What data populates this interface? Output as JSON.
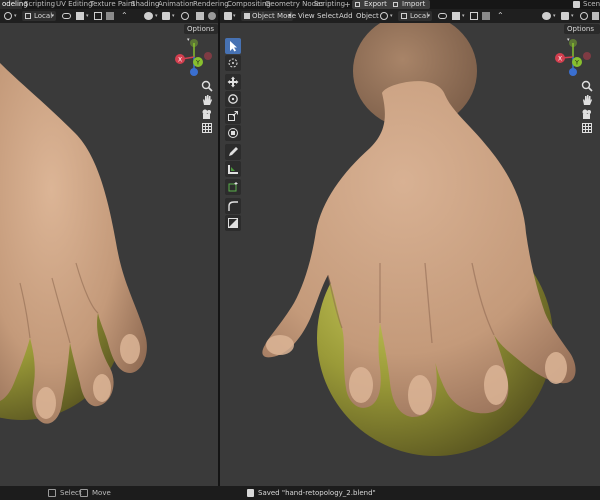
{
  "workspace_tabs": [
    {
      "label": "odeling",
      "active": true
    },
    {
      "label": "Scripting",
      "active": false
    },
    {
      "label": "UV Editing",
      "active": false
    },
    {
      "label": "Texture Paint",
      "active": false
    },
    {
      "label": "Shading",
      "active": false
    },
    {
      "label": "Animation",
      "active": false
    },
    {
      "label": "Rendering",
      "active": false
    },
    {
      "label": "Compositing",
      "active": false
    },
    {
      "label": "Geometry Nodes",
      "active": false
    },
    {
      "label": "Scripting",
      "active": false
    }
  ],
  "add_tab_label": "+",
  "file_buttons": {
    "export": "Export",
    "import": "Import"
  },
  "scene_label": "Scen",
  "left_view": {
    "pivot_label": "Local",
    "options_label": "Options"
  },
  "right_view": {
    "mode_label": "Object Mode",
    "menus": [
      "View",
      "Select",
      "Add",
      "Object"
    ],
    "pivot_label": "Local",
    "options_label": "Options"
  },
  "gizmo": {
    "axis_x_label": "X",
    "axis_y_label": "Y",
    "axis_x_color": "#d33f4f",
    "axis_y_color": "#88c02e",
    "axis_z_color": "#3a6fd0"
  },
  "scene_colors": {
    "viewport_bg": "#3a3a3a",
    "skin": "#c99f7f",
    "sphere": "#9a9a38",
    "active_tool": "#4772b3"
  },
  "status": {
    "select_label": "Select",
    "move_label": "Move",
    "saved_message": "Saved \"hand-retopology_2.blend\""
  }
}
